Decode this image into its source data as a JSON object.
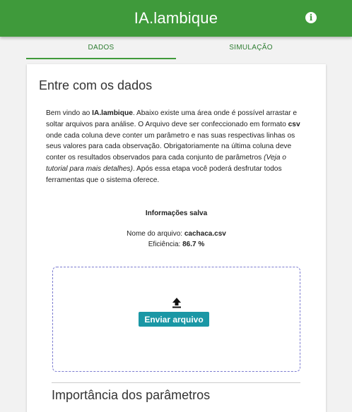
{
  "app": {
    "title": "IA.lambique",
    "info_icon": "info-icon"
  },
  "tabs": [
    {
      "label": "DADOS",
      "active": true
    },
    {
      "label": "SIMULAÇÃO",
      "active": false
    }
  ],
  "card": {
    "title": "Entre com os dados",
    "intro": {
      "p1": "Bem vindo ao ",
      "brand": "IA.lambique",
      "p2": ". Abaixo existe uma área onde é possível arrastar e soltar arquivos para análise. O Arquivo deve ser confeccionado em formato ",
      "format": "csv",
      "p3": " onde cada coluna deve conter um parâmetro e nas suas respectivas linhas os seus valores para cada observação. Obrigatoriamente na última coluna deve conter os resultados observados para cada conjunto de parâmetros ",
      "tutorial": "(Veja o tutorial para mais detalhes)",
      "p4": ". Após essa etapa você poderá desfrutar todos ferramentas que o sistema oferece."
    },
    "saved": {
      "heading": "Informações salva",
      "file_label": "Nome do arquivo: ",
      "file_value": "cachaca.csv",
      "eff_label": "Eficiência: ",
      "eff_value": "86.7 %"
    },
    "upload": {
      "icon": "upload-icon",
      "button_label": "Enviar arquivo"
    },
    "importance_title": "Importância dos parâmetros"
  },
  "colors": {
    "appbar": "#3f9a3b",
    "tab_text": "#2e7d32",
    "upload_button": "#1a97a5",
    "dropzone_border": "#7b7bd0"
  }
}
